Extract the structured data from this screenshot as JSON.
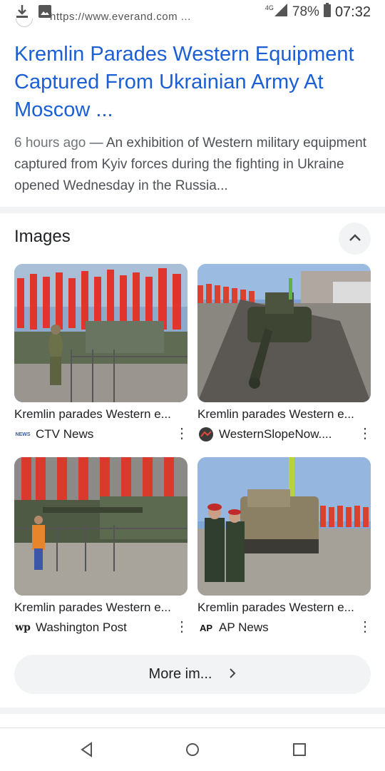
{
  "status_bar": {
    "network": "4G",
    "battery": "78%",
    "time": "07:32"
  },
  "result": {
    "url": "https://www.everand.com ...",
    "headline": "Kremlin Parades Western Equipment Captured From Ukrainian Army At Moscow ...",
    "snippet_date": "6 hours ago",
    "snippet_text": " — An exhibition of Western military equipment captured from Kyiv forces during the fighting in Ukraine opened Wednesday in the Russia..."
  },
  "images_section": {
    "title": "Images",
    "items": [
      {
        "title": "Kremlin parades Western e...",
        "source": "CTV News",
        "source_icon": "ctv-news-logo"
      },
      {
        "title": "Kremlin parades Western e...",
        "source": "WesternSlopeNow....",
        "source_icon": "westernslopenow-logo"
      },
      {
        "title": "Kremlin parades Western e...",
        "source": "Washington Post",
        "source_icon": "washington-post-logo"
      },
      {
        "title": "Kremlin parades Western e...",
        "source": "AP News",
        "source_icon": "ap-news-logo"
      }
    ],
    "more_label": "More im..."
  },
  "icons": {
    "ctv": "NEWS",
    "wapo": "wp",
    "ap": "AP"
  },
  "colors": {
    "link": "#1a5fd6",
    "chip_bg": "#f1f3f4"
  }
}
